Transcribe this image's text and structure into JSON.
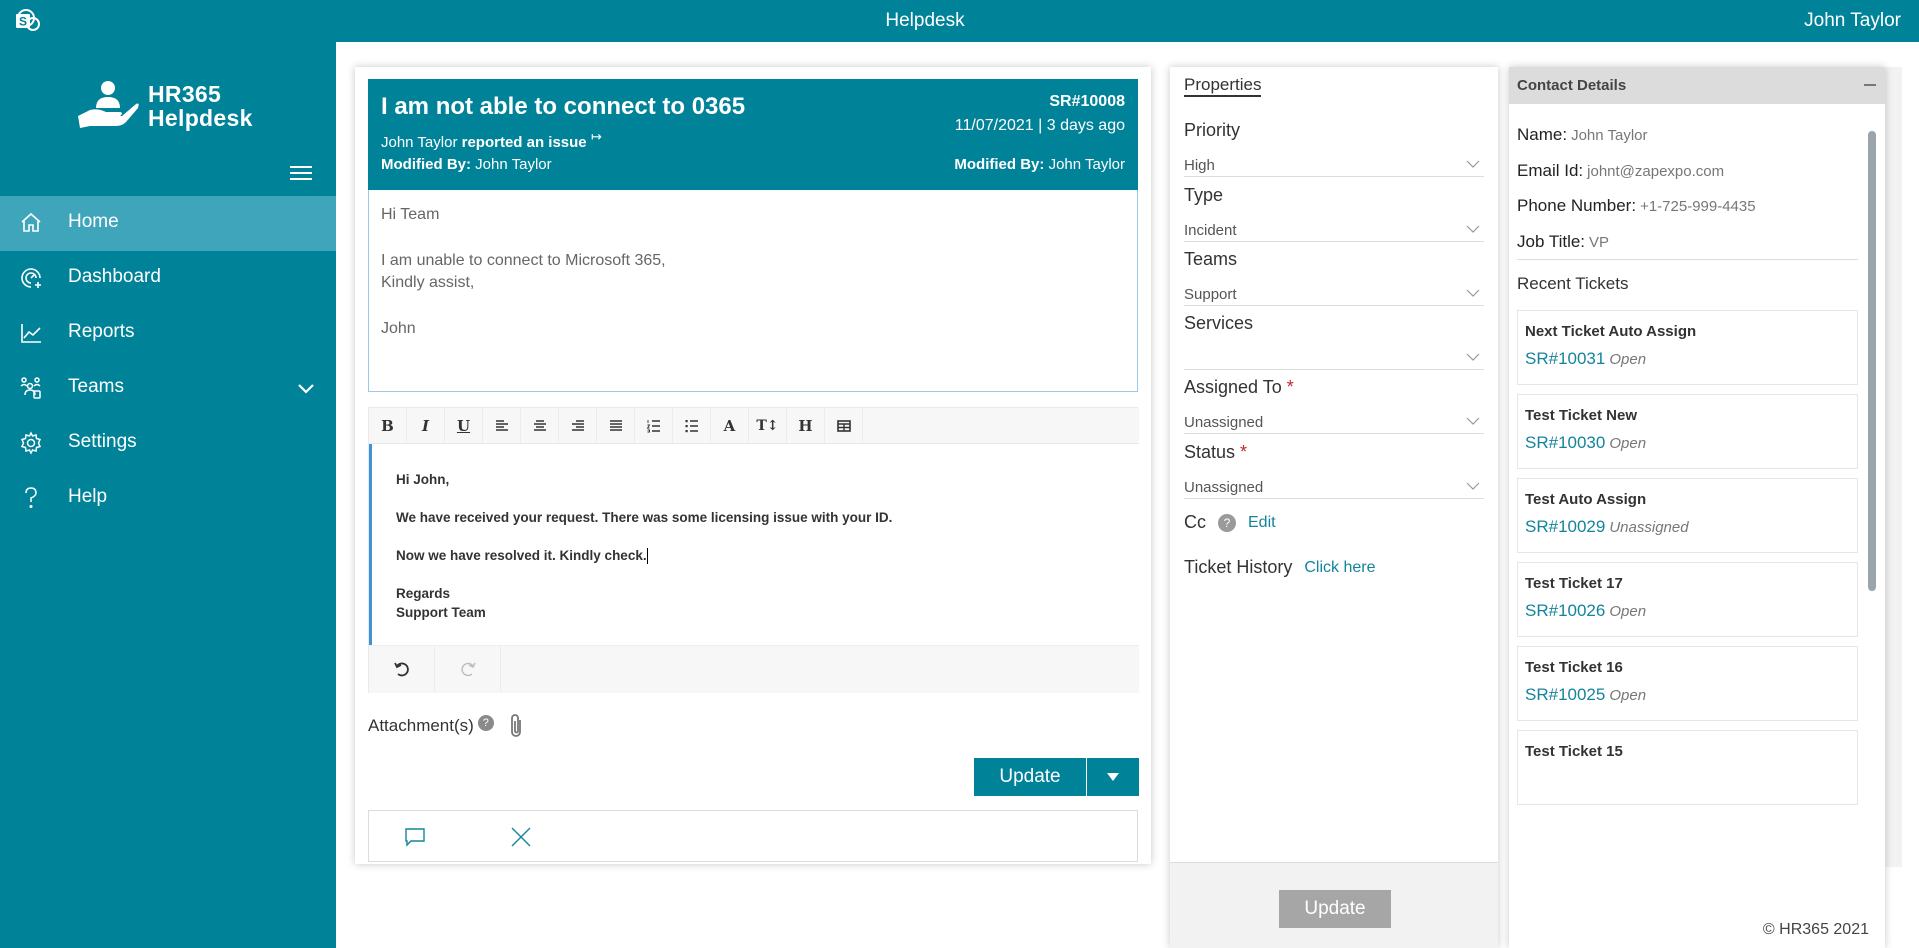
{
  "topbar": {
    "app_icon": "sharepoint-logo-icon",
    "title": "Helpdesk",
    "user": "John Taylor"
  },
  "brand": {
    "line1": "HR365",
    "line2": "Helpdesk",
    "icon": "hand-with-person-icon"
  },
  "sidebar": {
    "items": [
      {
        "label": "Home",
        "icon": "home-icon",
        "active": true
      },
      {
        "label": "Dashboard",
        "icon": "dashboard-gauge-icon"
      },
      {
        "label": "Reports",
        "icon": "line-chart-icon"
      },
      {
        "label": "Teams",
        "icon": "teams-people-icon",
        "expandable": true
      },
      {
        "label": "Settings",
        "icon": "gear-icon"
      },
      {
        "label": "Help",
        "icon": "question-icon"
      }
    ]
  },
  "ticket": {
    "title": "I am not able to connect to 0365",
    "reporter": "John Taylor",
    "reported_text": "reported an issue",
    "modified_label": "Modified By:",
    "modified_by_left": "John Taylor",
    "sr_number": "SR#10008",
    "date": "11/07/2021 | 3 days ago",
    "modified_by_right": "John Taylor",
    "body": {
      "greeting": "Hi Team",
      "line1": "I am unable to connect to Microsoft 365,",
      "line2": "Kindly assist,",
      "signoff": "John"
    }
  },
  "editor": {
    "toolbar": [
      "Bold",
      "Italic",
      "Underline",
      "Align left",
      "Align center",
      "Align right",
      "Justify",
      "Ordered list",
      "Unordered list",
      "Font color",
      "Font size",
      "Heading",
      "Insert table"
    ],
    "content": {
      "greeting": "Hi John,",
      "para1": "We have received your request. There was some licensing issue with your ID.",
      "para2": "Now we have resolved it. Kindly check.",
      "regards": "Regards",
      "team": "Support Team"
    },
    "undo_label": "Undo",
    "redo_label": "Redo"
  },
  "attachments": {
    "label": "Attachment(s)",
    "help": "?"
  },
  "actions": {
    "update": "Update"
  },
  "properties": {
    "title": "Properties",
    "fields": {
      "priority": {
        "label": "Priority",
        "value": "High"
      },
      "type": {
        "label": "Type",
        "value": "Incident"
      },
      "teams": {
        "label": "Teams",
        "value": "Support"
      },
      "services": {
        "label": "Services",
        "value": ""
      },
      "assigned_to": {
        "label": "Assigned To",
        "value": "Unassigned",
        "required": "*"
      },
      "status": {
        "label": "Status",
        "value": "Unassigned",
        "required": "*"
      }
    },
    "cc_label": "Cc",
    "cc_help": "?",
    "cc_edit": "Edit",
    "history_label": "Ticket History",
    "history_link": "Click here",
    "update": "Update"
  },
  "contact": {
    "title": "Contact Details",
    "name_label": "Name:",
    "name": "John Taylor",
    "email_label": "Email Id:",
    "email": "johnt@zapexpo.com",
    "phone_label": "Phone Number:",
    "phone": "+1-725-999-4435",
    "job_label": "Job Title:",
    "job": "VP",
    "recent_title": "Recent Tickets",
    "recent_tickets": [
      {
        "title": "Next Ticket Auto Assign",
        "sr": "SR#10031",
        "status": "Open"
      },
      {
        "title": "Test Ticket New",
        "sr": "SR#10030",
        "status": "Open"
      },
      {
        "title": "Test Auto Assign",
        "sr": "SR#10029",
        "status": "Unassigned"
      },
      {
        "title": "Test Ticket 17",
        "sr": "SR#10026",
        "status": "Open"
      },
      {
        "title": "Test Ticket 16",
        "sr": "SR#10025",
        "status": "Open"
      },
      {
        "title": "Test Ticket 15",
        "sr": "",
        "status": ""
      }
    ],
    "copyright": "© HR365 2021"
  },
  "colors": {
    "brand": "#008299",
    "active_nav": "#3fa5ba",
    "link": "#14849c",
    "required": "#c4262e",
    "disabled_button": "#a6a6a6"
  }
}
